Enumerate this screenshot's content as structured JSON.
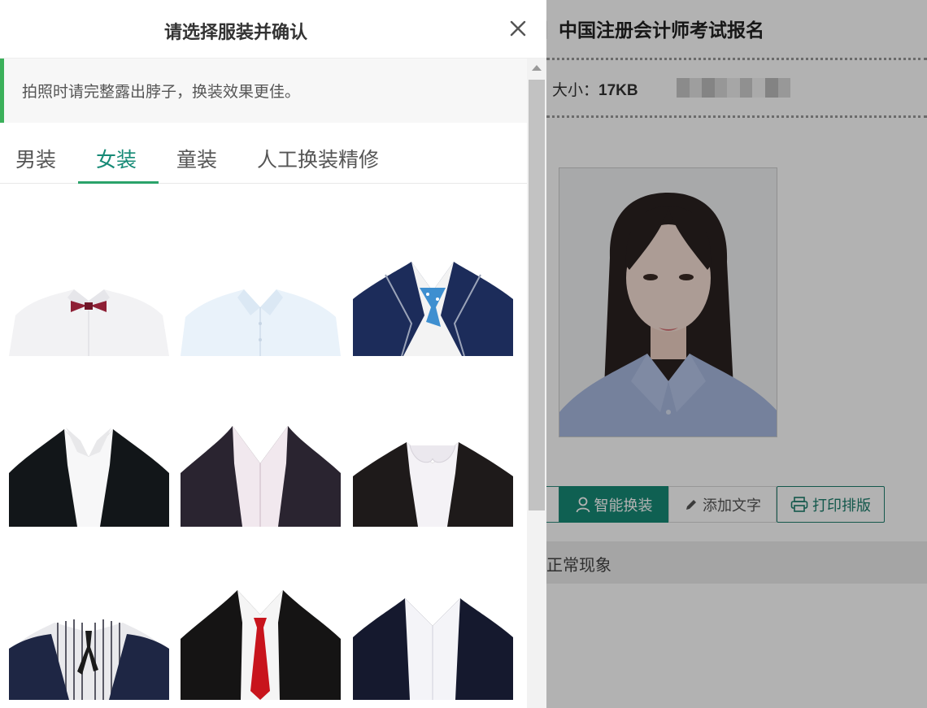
{
  "background_page": {
    "title": "】中国注册会计师考试报名",
    "size_label": "大小：",
    "size_value": "17KB",
    "toolbar": {
      "smart_change_label": "智能换装",
      "add_text_label": "添加文字",
      "print_layout_label": "打印排版"
    },
    "notice_text": "正常现象"
  },
  "drawer": {
    "title": "请选择服装并确认",
    "tip": "拍照时请完整露出脖子，换装效果更佳。",
    "tabs": [
      {
        "label": "男装",
        "active": false
      },
      {
        "label": "女装",
        "active": true
      },
      {
        "label": "童装",
        "active": false
      },
      {
        "label": "人工换装精修",
        "active": false
      }
    ],
    "garments": [
      "white-shirt-red-bowtie",
      "light-blue-shirt",
      "navy-blazer-blue-scarf",
      "black-blazer-white-shirt",
      "dark-blazer-pink-shirt",
      "black-blazer-round-collar",
      "navy-vest-striped-shirt",
      "black-suit-red-tie",
      "navy-blazer-white-shirt"
    ]
  },
  "colors": {
    "accent": "#168a76",
    "tab_active": "#168a76",
    "tip_border": "#3bb05a"
  }
}
